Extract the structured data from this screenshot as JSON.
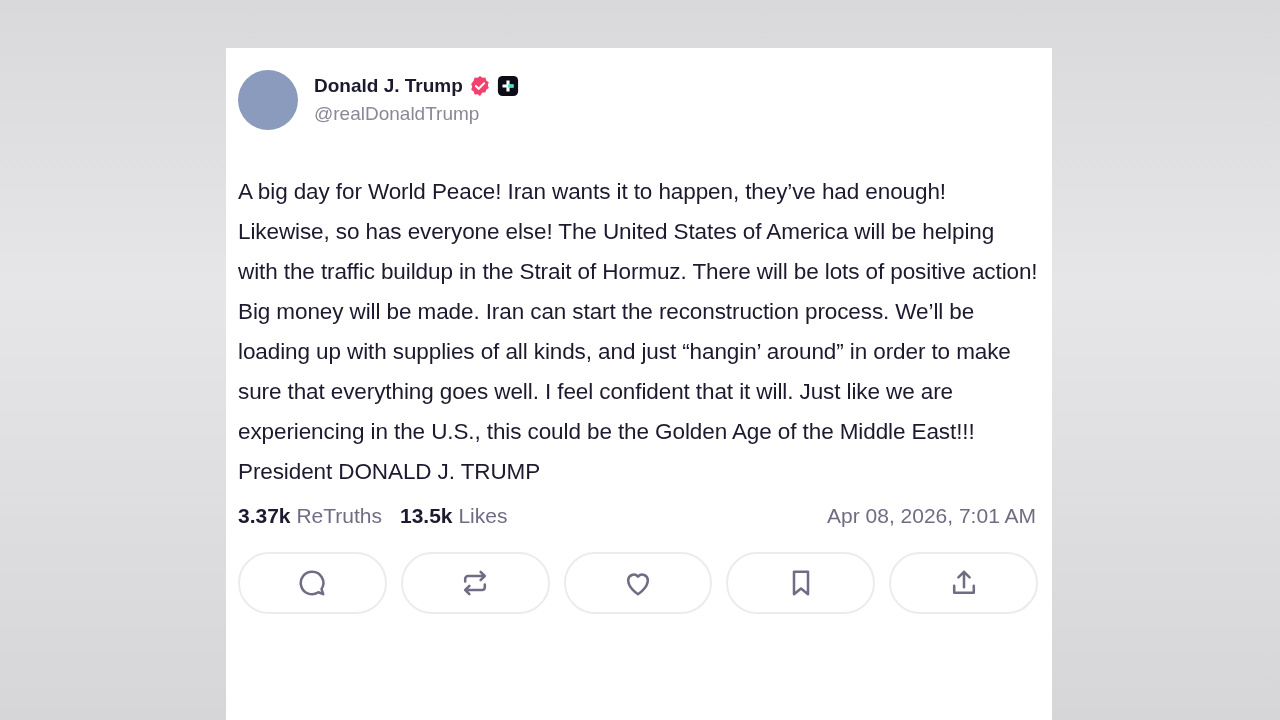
{
  "post": {
    "author": {
      "name": "Donald J. Trump",
      "handle": "@realDonaldTrump",
      "verified": true,
      "plus_badge": true
    },
    "text": "A big day for World Peace! Iran wants it to happen, they’ve had enough! Likewise, so has everyone else! The United States of America will be helping with the traffic buildup in the Strait of Hormuz. There will be lots of positive action! Big money will be made. Iran can start the reconstruction process. We’ll be loading up with supplies of all kinds, and just “hangin’ around” in order to make sure that everything goes well. I feel confident that it will. Just like we are experiencing in the U.S., this could be the Golden Age of the Middle East!!! President DONALD J. TRUMP",
    "stats": [
      "**3.37k** ReTruths",
      "**13.5k** Likes"
    ],
    "timestamp": "Apr 08, 2026, 7:01 AM",
    "actions": [
      {
        "kind": "reply"
      },
      {
        "kind": "retruth"
      },
      {
        "kind": "like"
      },
      {
        "kind": "bookmark"
      },
      {
        "kind": "share"
      }
    ]
  }
}
